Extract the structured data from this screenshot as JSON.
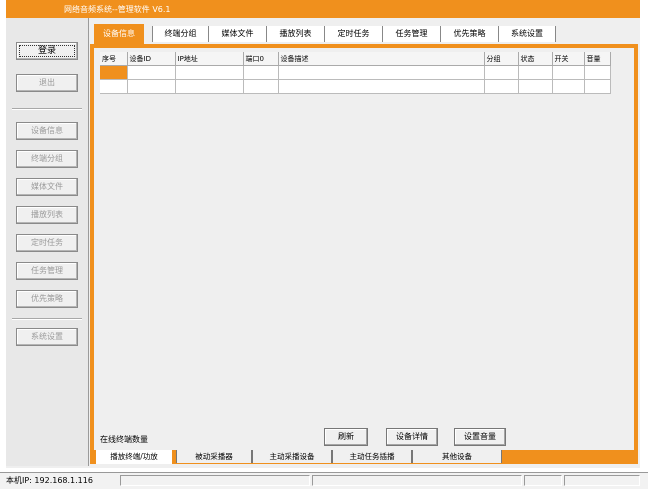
{
  "window": {
    "title": "网络音频系统--管理软件 V6.1"
  },
  "sidebar": {
    "login": "登录",
    "logout": "退出",
    "items": [
      "设备信息",
      "终端分组",
      "媒体文件",
      "播放列表",
      "定时任务",
      "任务管理",
      "优先策略",
      "系统设置"
    ]
  },
  "tabs": [
    "设备信息",
    "终端分组",
    "媒体文件",
    "播放列表",
    "定时任务",
    "任务管理",
    "优先策略",
    "系统设置"
  ],
  "active_tab": 0,
  "table": {
    "columns": [
      "序号",
      "设备ID",
      "IP地址",
      "端口0",
      "设备描述",
      "分组",
      "状态",
      "开关",
      "音量"
    ],
    "rows": [
      [
        "",
        "",
        "",
        "",
        "",
        "",
        "",
        "",
        ""
      ],
      [
        "",
        "",
        "",
        "",
        "",
        "",
        "",
        "",
        ""
      ]
    ]
  },
  "footer": {
    "online_label": "在线终端数量",
    "refresh": "刷新",
    "device_detail": "设备详情",
    "set_volume": "设置音量"
  },
  "bottom_tabs": [
    "播放终端/功放",
    "被动采播器",
    "主动采播设备",
    "主动任务插播",
    "其他设备"
  ],
  "statusbar": {
    "ip_text": "本机IP: 192.168.1.116"
  },
  "colors": {
    "accent": "#f0901d",
    "background": "#efefef"
  }
}
